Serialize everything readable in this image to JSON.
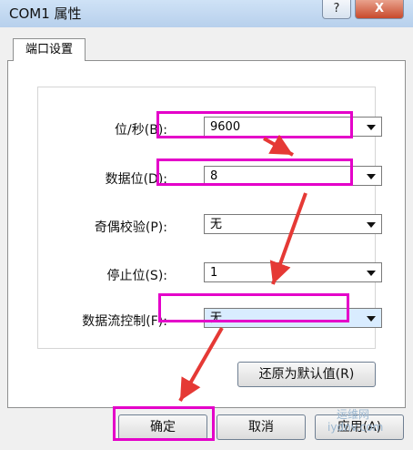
{
  "window": {
    "title": "COM1 属性",
    "help_label": "?",
    "close_label": "X"
  },
  "tab": {
    "label": "端口设置"
  },
  "fields": [
    {
      "label": "位/秒(B):",
      "value": "9600"
    },
    {
      "label": "数据位(D):",
      "value": "8"
    },
    {
      "label": "奇偶校验(P):",
      "value": "无"
    },
    {
      "label": "停止位(S):",
      "value": "1"
    },
    {
      "label": "数据流控制(F):",
      "value": "无"
    }
  ],
  "buttons": {
    "restore_defaults": "还原为默认值(R)",
    "ok": "确定",
    "cancel": "取消",
    "apply": "应用(A)"
  },
  "watermark": {
    "text1": "运维网",
    "text2": "iydnv.com"
  },
  "colors": {
    "highlight": "#e400c9",
    "arrow": "#e53935"
  }
}
